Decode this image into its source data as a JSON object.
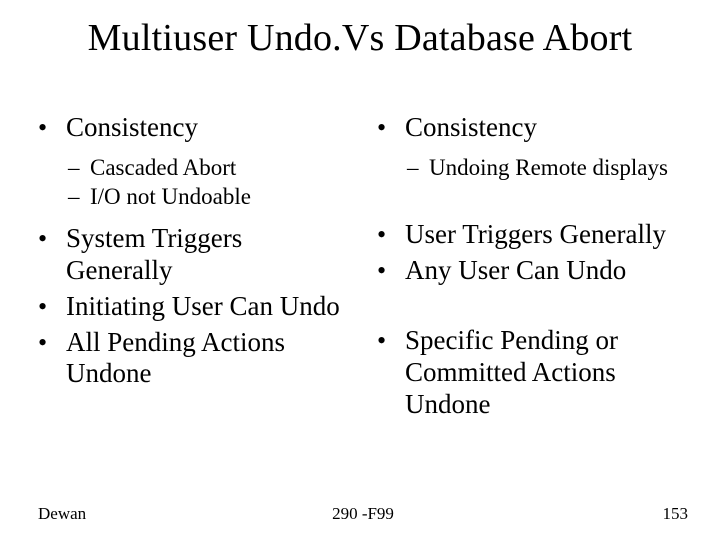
{
  "title": "Multiuser Undo.Vs Database Abort",
  "left": {
    "items": [
      {
        "type": "b1",
        "text": "Consistency"
      },
      {
        "type": "b2",
        "text": "Cascaded Abort"
      },
      {
        "type": "b2",
        "text": "I/O not Undoable"
      },
      {
        "type": "b1",
        "text": "System Triggers Generally"
      },
      {
        "type": "b1",
        "text": "Initiating User Can Undo"
      },
      {
        "type": "b1",
        "text": "All Pending Actions Undone"
      }
    ]
  },
  "right": {
    "items": [
      {
        "type": "b1",
        "text": "Consistency"
      },
      {
        "type": "b2",
        "text": "Undoing Remote displays"
      },
      {
        "type": "b1",
        "text": "User Triggers Generally"
      },
      {
        "type": "b1",
        "text": "Any User Can Undo"
      },
      {
        "type": "gap",
        "text": ""
      },
      {
        "type": "b1",
        "text": "Specific Pending or Committed Actions Undone"
      }
    ]
  },
  "footer": {
    "left": "Dewan",
    "center": "290 -F99",
    "right": "153"
  }
}
